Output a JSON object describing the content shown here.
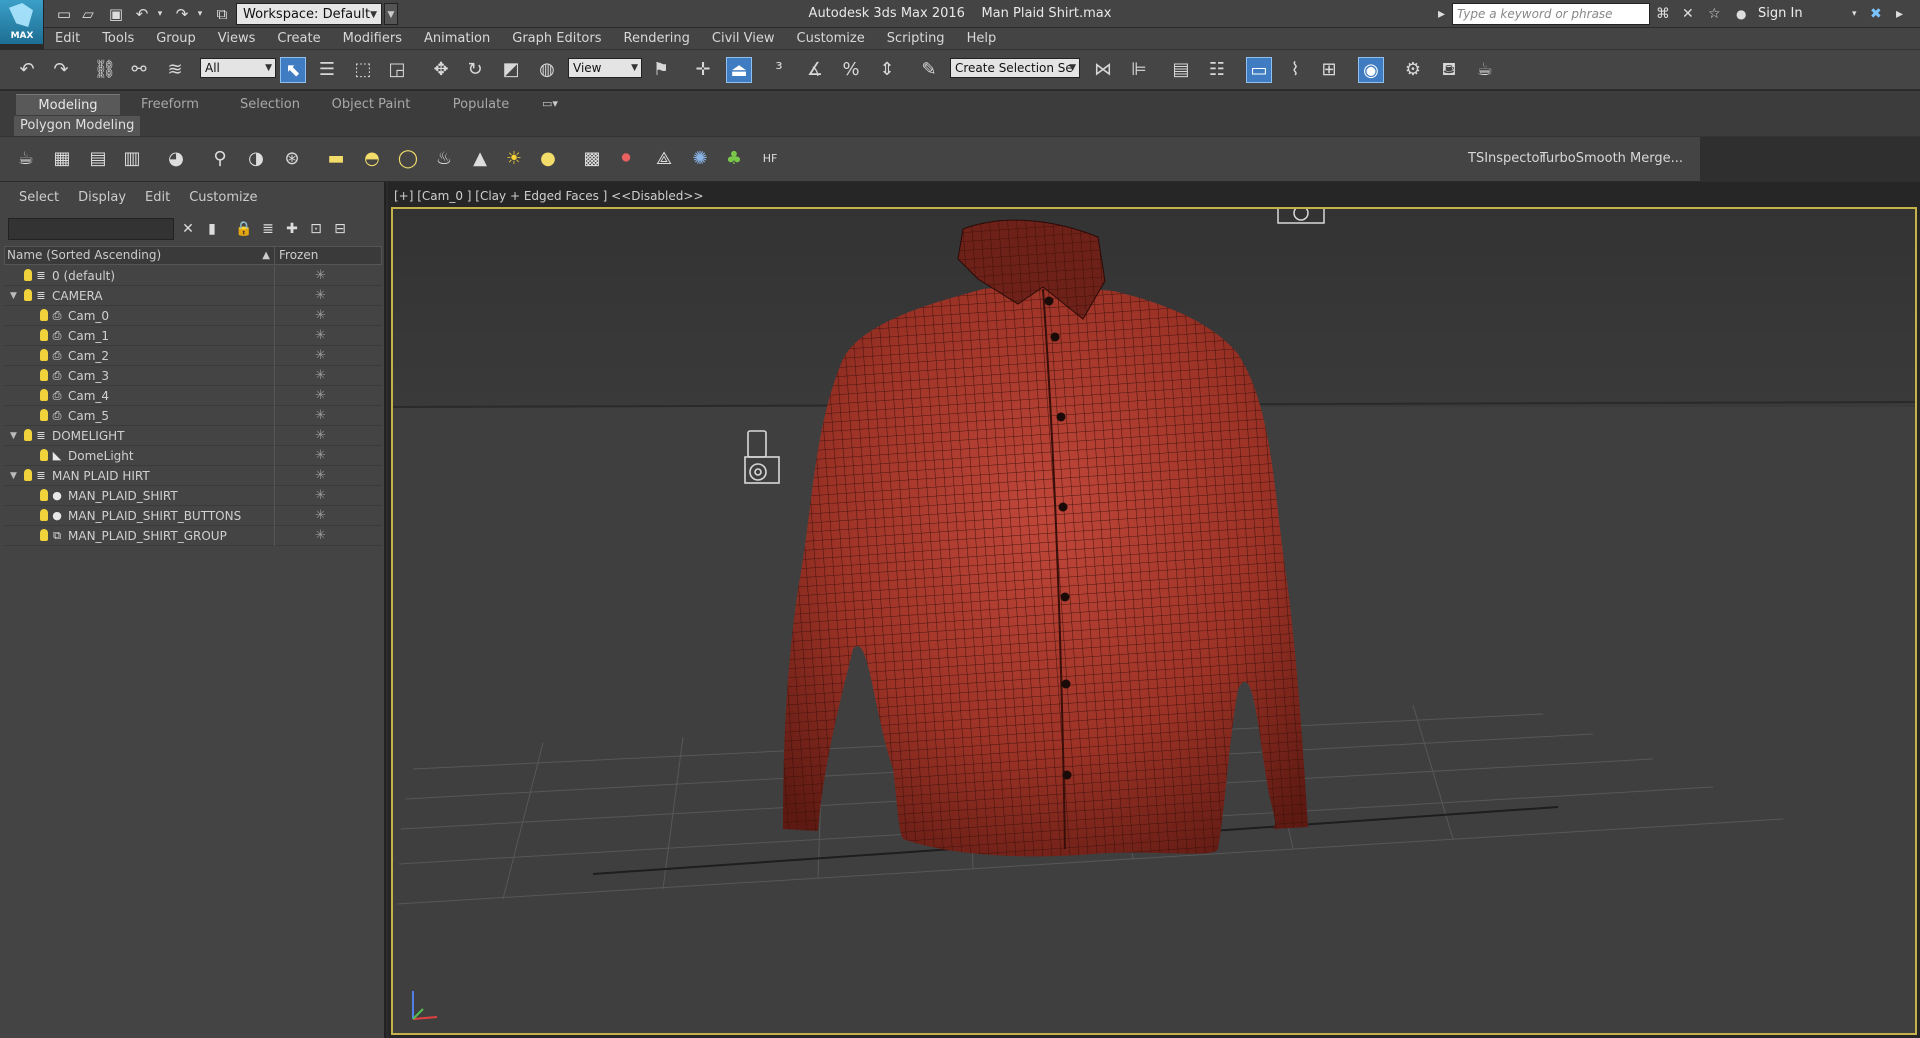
{
  "app": {
    "logo_label": "MAX",
    "title": "Autodesk 3ds Max 2016",
    "file": "Man Plaid Shirt.max",
    "workspace": "Workspace: Default",
    "search_placeholder": "Type a keyword or phrase",
    "sign_in": "Sign In"
  },
  "menu": [
    "Edit",
    "Tools",
    "Group",
    "Views",
    "Create",
    "Modifiers",
    "Animation",
    "Graph Editors",
    "Rendering",
    "Civil View",
    "Customize",
    "Scripting",
    "Help"
  ],
  "toolbar": {
    "selection_filter": "All",
    "reference_coord": "View",
    "named_selection": "Create Selection Se"
  },
  "ribbon": {
    "tabs": [
      {
        "label": "Modeling",
        "active": true
      },
      {
        "label": "Freeform",
        "active": false
      },
      {
        "label": "Selection",
        "active": false
      },
      {
        "label": "Object Paint",
        "active": false
      },
      {
        "label": "Populate",
        "active": false
      }
    ],
    "sub_panel": "Polygon Modeling",
    "right_tools": [
      "TSInspector",
      "TurboSmooth",
      "Merge..."
    ]
  },
  "explorer": {
    "menu": [
      "Select",
      "Display",
      "Edit",
      "Customize"
    ],
    "col_name": "Name (Sorted Ascending)",
    "col_frozen": "Frozen",
    "rows": [
      {
        "label": "0 (default)",
        "level": 0,
        "type": "layer",
        "expander": ""
      },
      {
        "label": "CAMERA",
        "level": 0,
        "type": "layer",
        "expander": "▼"
      },
      {
        "label": "Cam_0",
        "level": 1,
        "type": "camera",
        "expander": ""
      },
      {
        "label": "Cam_1",
        "level": 1,
        "type": "camera",
        "expander": ""
      },
      {
        "label": "Cam_2",
        "level": 1,
        "type": "camera",
        "expander": ""
      },
      {
        "label": "Cam_3",
        "level": 1,
        "type": "camera",
        "expander": ""
      },
      {
        "label": "Cam_4",
        "level": 1,
        "type": "camera",
        "expander": ""
      },
      {
        "label": "Cam_5",
        "level": 1,
        "type": "camera",
        "expander": ""
      },
      {
        "label": "DOMELIGHT",
        "level": 0,
        "type": "layer",
        "expander": "▼"
      },
      {
        "label": "DomeLight",
        "level": 1,
        "type": "light",
        "expander": ""
      },
      {
        "label": "MAN PLAID HIRT",
        "level": 0,
        "type": "layer",
        "expander": "▼"
      },
      {
        "label": "MAN_PLAID_SHIRT",
        "level": 1,
        "type": "mesh",
        "expander": ""
      },
      {
        "label": "MAN_PLAID_SHIRT_BUTTONS",
        "level": 1,
        "type": "mesh",
        "expander": ""
      },
      {
        "label": "MAN_PLAID_SHIRT_GROUP",
        "level": 1,
        "type": "group",
        "expander": ""
      }
    ],
    "frozen_glyph": "✳"
  },
  "viewport": {
    "label": "[+] [Cam_0 ] [Clay + Edged Faces ]  <<Disabled>>",
    "shirt_color": "#9c3226",
    "wire_color": "#3a0f0a",
    "border_color": "#c5b24a"
  }
}
